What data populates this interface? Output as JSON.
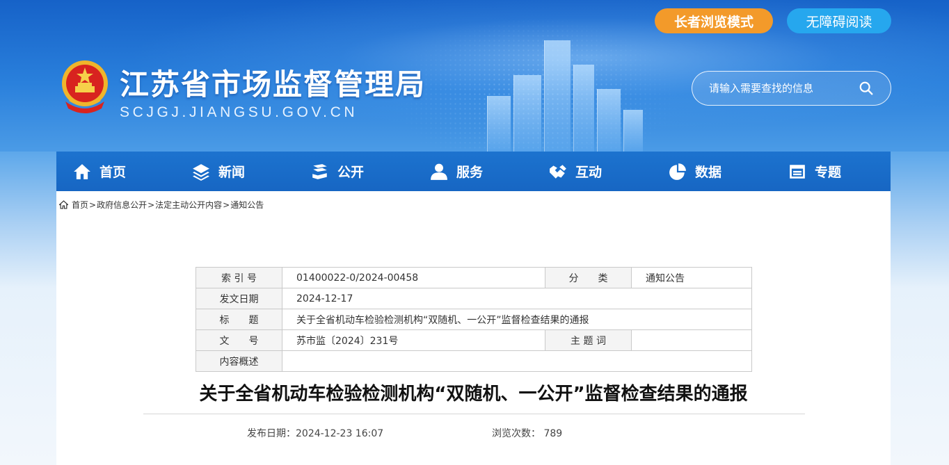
{
  "header": {
    "elder_mode_label": "长者浏览模式",
    "accessibility_label": "无障碍阅读",
    "site_title": "江苏省市场监督管理局",
    "site_domain": "SCJGJ.JIANGSU.GOV.CN",
    "search_placeholder": "请输入需要查找的信息"
  },
  "nav": {
    "items": [
      {
        "label": "首页",
        "icon": "home-icon"
      },
      {
        "label": "新闻",
        "icon": "layers-icon"
      },
      {
        "label": "公开",
        "icon": "stack-icon"
      },
      {
        "label": "服务",
        "icon": "user-icon"
      },
      {
        "label": "互动",
        "icon": "handshake-icon"
      },
      {
        "label": "数据",
        "icon": "pie-chart-icon"
      },
      {
        "label": "专题",
        "icon": "window-icon"
      }
    ]
  },
  "breadcrumb": {
    "items": [
      "首页",
      "政府信息公开",
      "法定主动公开内容",
      "通知公告"
    ],
    "separator": ">"
  },
  "meta_table": {
    "index_label": "索 引 号",
    "index_value": "01400022-0/2024-00458",
    "category_label": "分　　类",
    "category_value": "通知公告",
    "date_label": "发文日期",
    "date_value": "2024-12-17",
    "title_label": "标　　题",
    "title_value": "关于全省机动车检验检测机构“双随机、一公开”监督检查结果的通报",
    "docno_label": "文　　号",
    "docno_value": "苏市监〔2024〕231号",
    "keywords_label": "主 题 词",
    "keywords_value": "",
    "summary_label": "内容概述",
    "summary_value": ""
  },
  "article": {
    "title": "关于全省机动车检验检测机构“双随机、一公开”监督检查结果的通报",
    "publish_label": "发布日期：2024-12-23 16:07",
    "views_label": "浏览次数：",
    "views_count": "789"
  },
  "colors": {
    "nav_bg": "#1766c3",
    "elder_button": "#f39a2a",
    "accessibility_button": "#26a7ee"
  }
}
